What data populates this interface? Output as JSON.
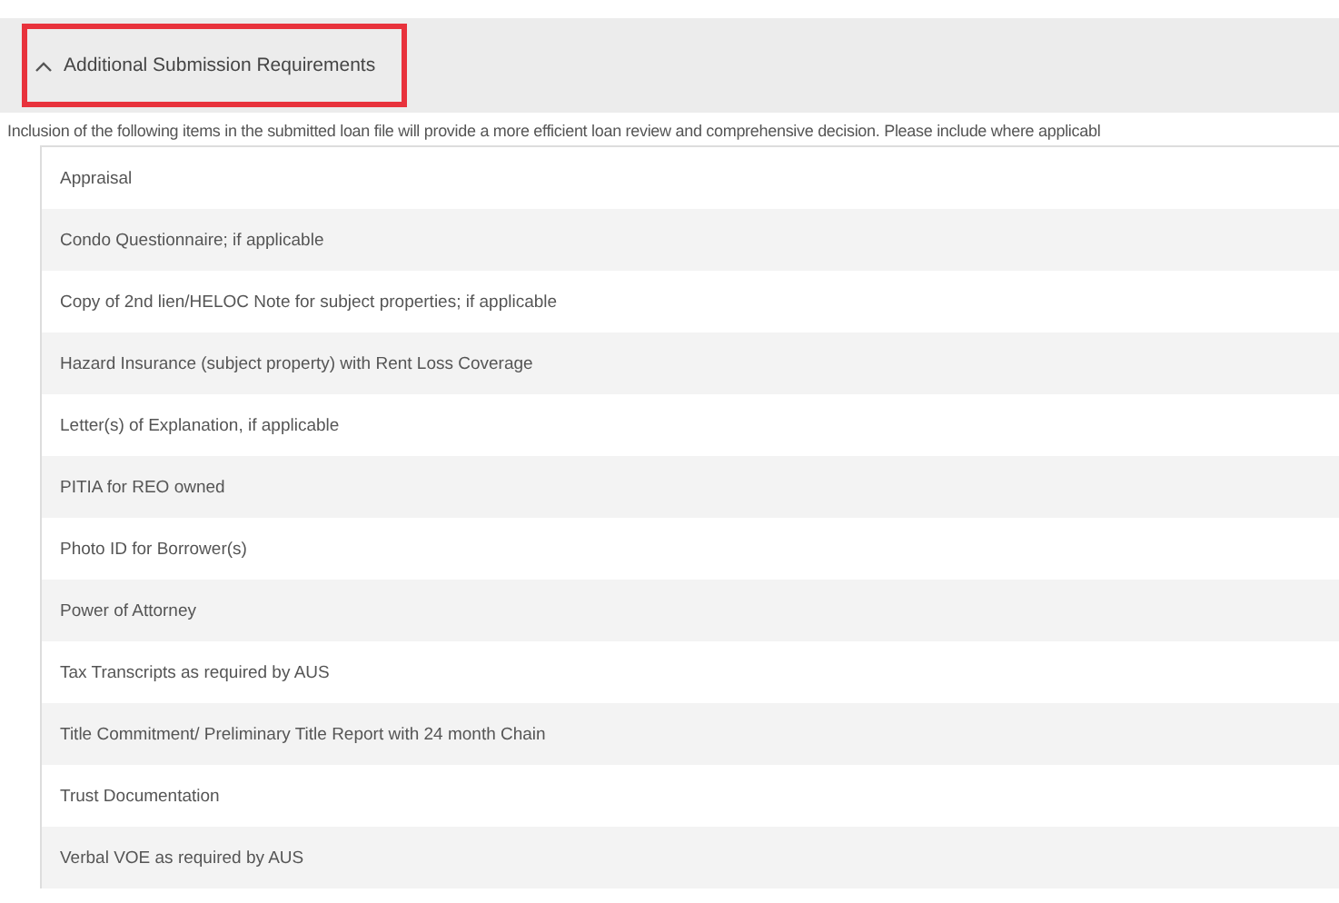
{
  "section": {
    "title": "Additional Submission Requirements",
    "expanded": true,
    "highlighted": true
  },
  "intro": "Inclusion of the following items in the submitted loan file will provide a more efficient loan review and comprehensive decision. Please include where applicabl",
  "items": [
    "Appraisal",
    "Condo Questionnaire; if applicable",
    "Copy of 2nd lien/HELOC Note for subject properties; if applicable",
    "Hazard Insurance (subject property) with Rent Loss Coverage",
    "Letter(s) of Explanation, if applicable",
    "PITIA for REO owned",
    "Photo ID for Borrower(s)",
    "Power of Attorney",
    "Tax Transcripts as required by AUS",
    "Title Commitment/ Preliminary Title Report with 24 month Chain",
    "Trust Documentation",
    "Verbal VOE as required by AUS"
  ]
}
